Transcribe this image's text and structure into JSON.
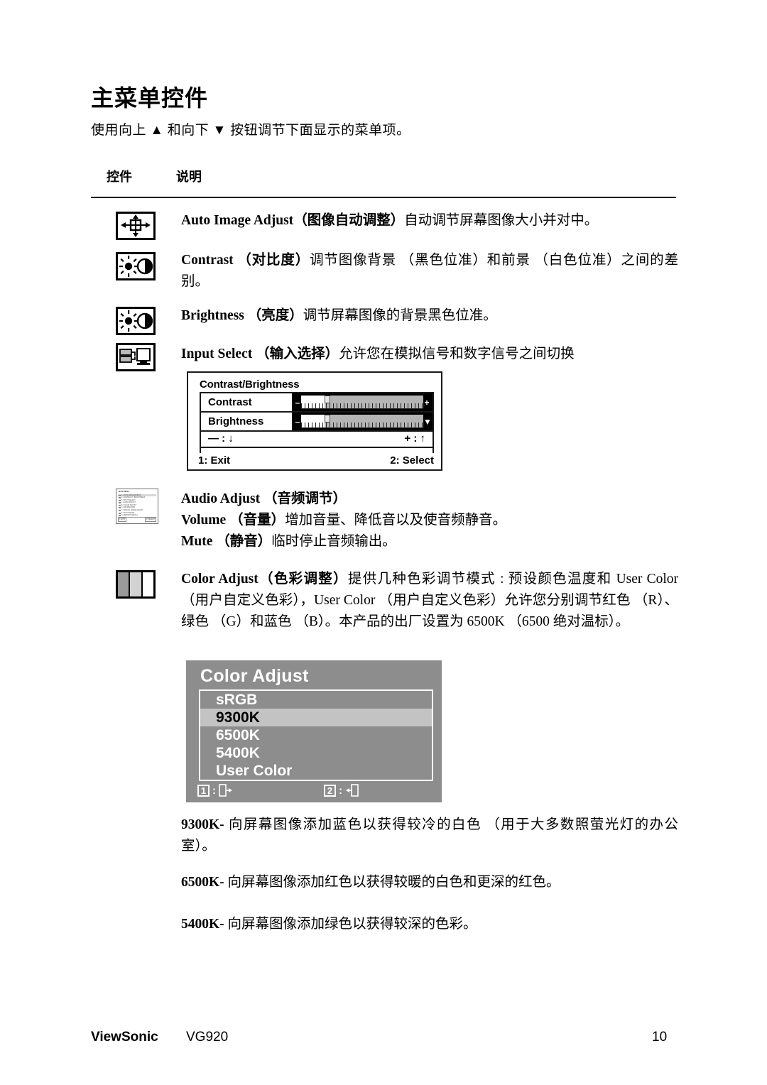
{
  "page": {
    "title": "主菜单控件",
    "subtitle": "使用向上 ▲ 和向下 ▼ 按钮调节下面显示的菜单项。",
    "columns": {
      "control": "控件",
      "description": "说明"
    }
  },
  "rows": [
    {
      "icon": "auto-image-adjust-icon",
      "term": "Auto Image Adjust",
      "term_cn": "（图像自动调整）",
      "desc": "自动调节屏幕图像大小并对中。"
    },
    {
      "icon": "contrast-icon",
      "term": "Contrast",
      "term_cn": "（对比度）",
      "desc": "调节图像背景 （黑色位准）和前景 （白色位准）之间的差别。"
    },
    {
      "icon": "brightness-icon",
      "term": "Brightness",
      "term_cn": "（亮度）",
      "desc": "调节屏幕图像的背景黑色位准。"
    },
    {
      "icon": "input-select-icon",
      "term": "Input Select",
      "term_cn": "（输入选择）",
      "desc": "允许您在模拟信号和数字信号之间切换"
    }
  ],
  "osd_contrast_brightness": {
    "header": "Contrast/Brightness",
    "items": [
      {
        "label": "Contrast",
        "minus": "–",
        "plus": "+",
        "value_percent": 19
      },
      {
        "label": "Brightness",
        "minus": "–",
        "plus": "▼",
        "value_percent": 19
      }
    ],
    "keys": {
      "minus": "— : ↓",
      "plus": "+ : ↑"
    },
    "footer": {
      "left": "1: Exit",
      "right": "2: Select"
    }
  },
  "audio_adjust": {
    "icon": "main-menu-thumbnail-icon",
    "term": "Audio Adjust",
    "term_cn": "（音频调节）",
    "lines": [
      {
        "term": "Volume",
        "term_cn": "（音量）",
        "desc": "增加音量、降低音以及使音频静音。"
      },
      {
        "term": "Mute",
        "term_cn": "（静音）",
        "desc": "临时停止音频输出。"
      }
    ],
    "thumb": {
      "title": "MAIN MENU",
      "items": [
        "1. AUTO IMAGE ADJUST",
        "2. CONTRAST / BRIGHTNESS",
        "3. INPUT SELECT",
        "4. AUDIO ADJUST",
        "5. COLOR ADJUST",
        "6. INFORMATION",
        "7. MANUAL IMAGE ADJUST",
        "8. SETUP MENU",
        "9. MEMORY RECALL"
      ],
      "footer_left": "1: EXIT",
      "footer_right": "2: SELECT"
    }
  },
  "color_adjust": {
    "icon": "color-bars-icon",
    "term": "Color Adjust",
    "term_cn": "（色彩调整）",
    "desc": "提供几种色彩调节模式 : 预设颜色温度和 User Color （用户自定义色彩），User Color （用户自定义色彩）允许您分别调节红色 （R）、绿色 （G）和蓝色 （B）。本产品的出厂设置为 6500K （6500 绝对温标）。"
  },
  "osd_color_adjust": {
    "title": "Color Adjust",
    "items": [
      {
        "label": "sRGB",
        "selected": false
      },
      {
        "label": "9300K",
        "selected": true
      },
      {
        "label": "6500K",
        "selected": false
      },
      {
        "label": "5400K",
        "selected": false
      },
      {
        "label": "User Color",
        "selected": false
      }
    ],
    "footer": [
      {
        "key": "1",
        "sep": ":",
        "icon": "exit-icon"
      },
      {
        "key": "2",
        "sep": ":",
        "icon": "enter-icon"
      }
    ]
  },
  "temperature_notes": [
    {
      "term": "9300K-",
      "desc": "向屏幕图像添加蓝色以获得较冷的白色 （用于大多数照萤光灯的办公室）。"
    },
    {
      "term": "6500K-",
      "desc": "向屏幕图像添加红色以获得较暖的白色和更深的红色。"
    },
    {
      "term": "5400K-",
      "desc": "向屏幕图像添加绿色以获得较深的色彩。"
    }
  ],
  "footer": {
    "brand": "ViewSonic",
    "model": "VG920",
    "page_number": "10"
  },
  "colors": {
    "osd_gray_bg": "#8d8d8d",
    "osd_selected_row": "#c3c3c3",
    "slider_track": "#b5b5b5",
    "ink": "#000000"
  }
}
